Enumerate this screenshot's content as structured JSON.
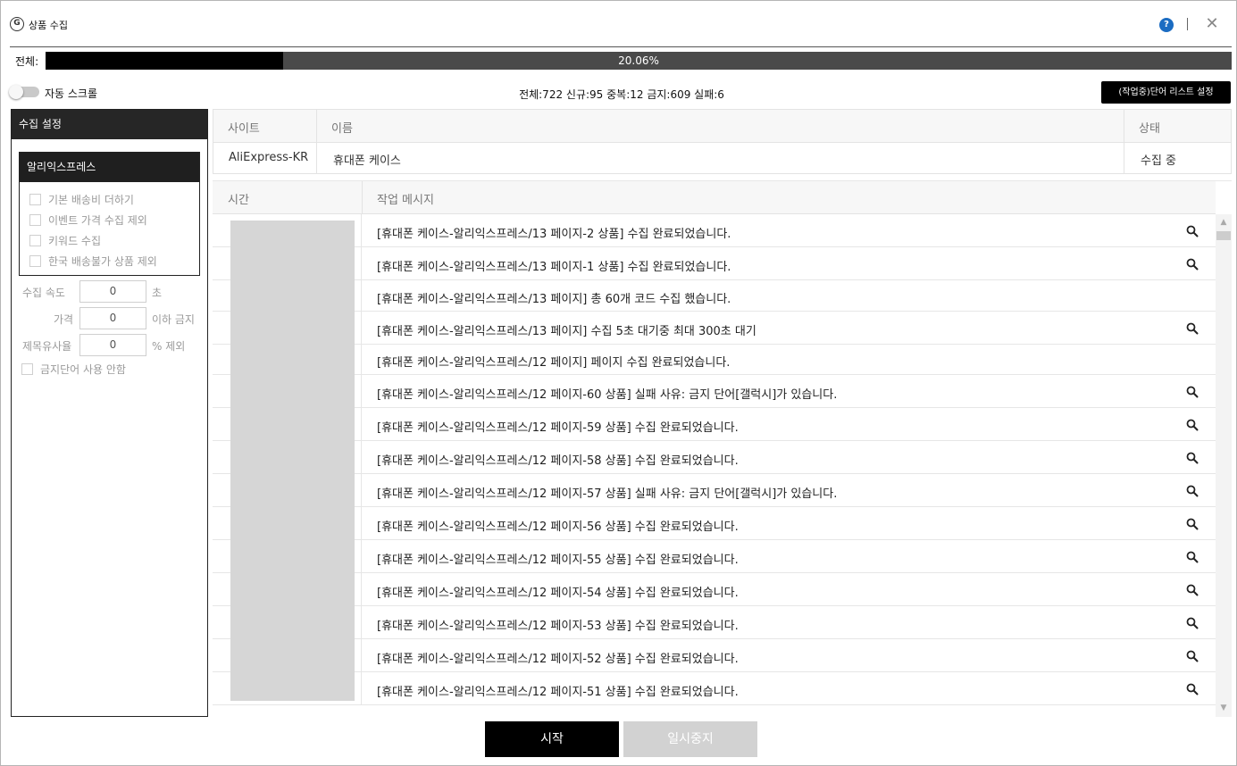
{
  "window": {
    "title": "상품 수집",
    "help_label": "?"
  },
  "progress": {
    "label": "전체:",
    "percent_text": "20.06%",
    "fraction": 0.2006
  },
  "toolbar": {
    "auto_scroll_label": "자동 스크롤",
    "auto_scroll_on": false,
    "stats": "전체:722 신규:95 중복:12 금지:609 실패:6",
    "wordlist_button": "(작업중)단어 리스트 설정"
  },
  "settings": {
    "header": "수집 설정",
    "group_title": "알리익스프레스",
    "options": [
      {
        "label": "기본 배송비 더하기",
        "checked": false
      },
      {
        "label": "이벤트 가격 수집 제외",
        "checked": false
      },
      {
        "label": "키워드 수집",
        "checked": false
      },
      {
        "label": "한국 배송불가 상품 제외",
        "checked": false
      }
    ],
    "speed": {
      "label": "수집 속도",
      "value": "0",
      "unit": "초"
    },
    "price": {
      "label": "가격",
      "value": "0",
      "unit": "이하 금지"
    },
    "similarity": {
      "label": "제목유사율",
      "value": "0",
      "unit": "% 제외"
    },
    "no_banned_words": {
      "label": "금지단어 사용 안함",
      "checked": false
    }
  },
  "site_table": {
    "headers": {
      "site": "사이트",
      "name": "이름",
      "status": "상태"
    },
    "row": {
      "site": "AliExpress-KR",
      "name": "휴대폰 케이스",
      "status": "수집 중"
    }
  },
  "log_table": {
    "headers": {
      "time": "시간",
      "message": "작업 메시지"
    },
    "rows": [
      {
        "message": "[휴대폰 케이스-알리익스프레스/13 페이지-2 상품] 수집 완료되었습니다.",
        "has_search": true
      },
      {
        "message": "[휴대폰 케이스-알리익스프레스/13 페이지-1 상품] 수집 완료되었습니다.",
        "has_search": true
      },
      {
        "message": "[휴대폰 케이스-알리익스프레스/13 페이지] 총 60개 코드 수집 했습니다.",
        "has_search": false
      },
      {
        "message": "[휴대폰 케이스-알리익스프레스/13 페이지] 수집 5초 대기중 최대 300초 대기",
        "has_search": true
      },
      {
        "message": "[휴대폰 케이스-알리익스프레스/12 페이지] 페이지 수집 완료되었습니다.",
        "has_search": false
      },
      {
        "message": "[휴대폰 케이스-알리익스프레스/12 페이지-60 상품] 실패 사유: 금지 단어[갤럭시]가 있습니다.",
        "has_search": true
      },
      {
        "message": "[휴대폰 케이스-알리익스프레스/12 페이지-59 상품] 수집 완료되었습니다.",
        "has_search": true
      },
      {
        "message": "[휴대폰 케이스-알리익스프레스/12 페이지-58 상품] 수집 완료되었습니다.",
        "has_search": true
      },
      {
        "message": "[휴대폰 케이스-알리익스프레스/12 페이지-57 상품] 실패 사유: 금지 단어[갤럭시]가 있습니다.",
        "has_search": true
      },
      {
        "message": "[휴대폰 케이스-알리익스프레스/12 페이지-56 상품] 수집 완료되었습니다.",
        "has_search": true
      },
      {
        "message": "[휴대폰 케이스-알리익스프레스/12 페이지-55 상품] 수집 완료되었습니다.",
        "has_search": true
      },
      {
        "message": "[휴대폰 케이스-알리익스프레스/12 페이지-54 상품] 수집 완료되었습니다.",
        "has_search": true
      },
      {
        "message": "[휴대폰 케이스-알리익스프레스/12 페이지-53 상품] 수집 완료되었습니다.",
        "has_search": true
      },
      {
        "message": "[휴대폰 케이스-알리익스프레스/12 페이지-52 상품] 수집 완료되었습니다.",
        "has_search": true
      },
      {
        "message": "[휴대폰 케이스-알리익스프레스/12 페이지-51 상품] 수집 완료되었습니다.",
        "has_search": true
      }
    ]
  },
  "buttons": {
    "start": "시작",
    "pause": "일시중지"
  }
}
